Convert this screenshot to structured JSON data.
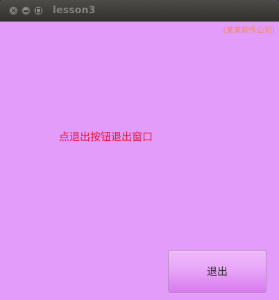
{
  "window": {
    "title": "lesson3",
    "background_color": "#e39cf9"
  },
  "titlebar": {
    "buttons": [
      {
        "name": "close",
        "icon": "close-icon"
      },
      {
        "name": "minimize",
        "icon": "minimize-icon"
      },
      {
        "name": "maximize",
        "icon": "maximize-icon"
      }
    ]
  },
  "main": {
    "corner_link": "(某某软件公司)",
    "message": "点退出按钮退出窗口",
    "message_color": "#e3133b",
    "quit_button_label": "退出"
  }
}
